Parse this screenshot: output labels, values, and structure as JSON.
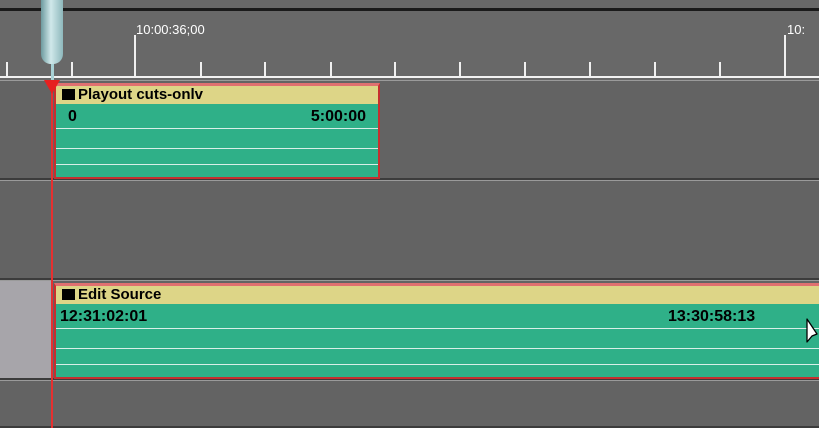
{
  "ruler": {
    "labels": [
      "10:00:36;00",
      "10:"
    ]
  },
  "tracks": {
    "playout": {
      "clip_title": "Playout cuts-onlv",
      "tc_in": "0",
      "tc_out": "5:00:00"
    },
    "edit_source": {
      "clip_title": "Edit Source",
      "tc_in": "12:31:02:01",
      "tc_out": "13:30:58:13"
    }
  },
  "colors": {
    "background": "#646464",
    "clip_body": "#2fb088",
    "clip_header": "#ddd587",
    "clip_border": "#c62f2f",
    "playhead": "#e63030",
    "selected_gutter": "#a7a5aa"
  },
  "icons": [
    "playhead-handle-icon",
    "clip-marker-icon",
    "mouse-cursor-icon"
  ]
}
